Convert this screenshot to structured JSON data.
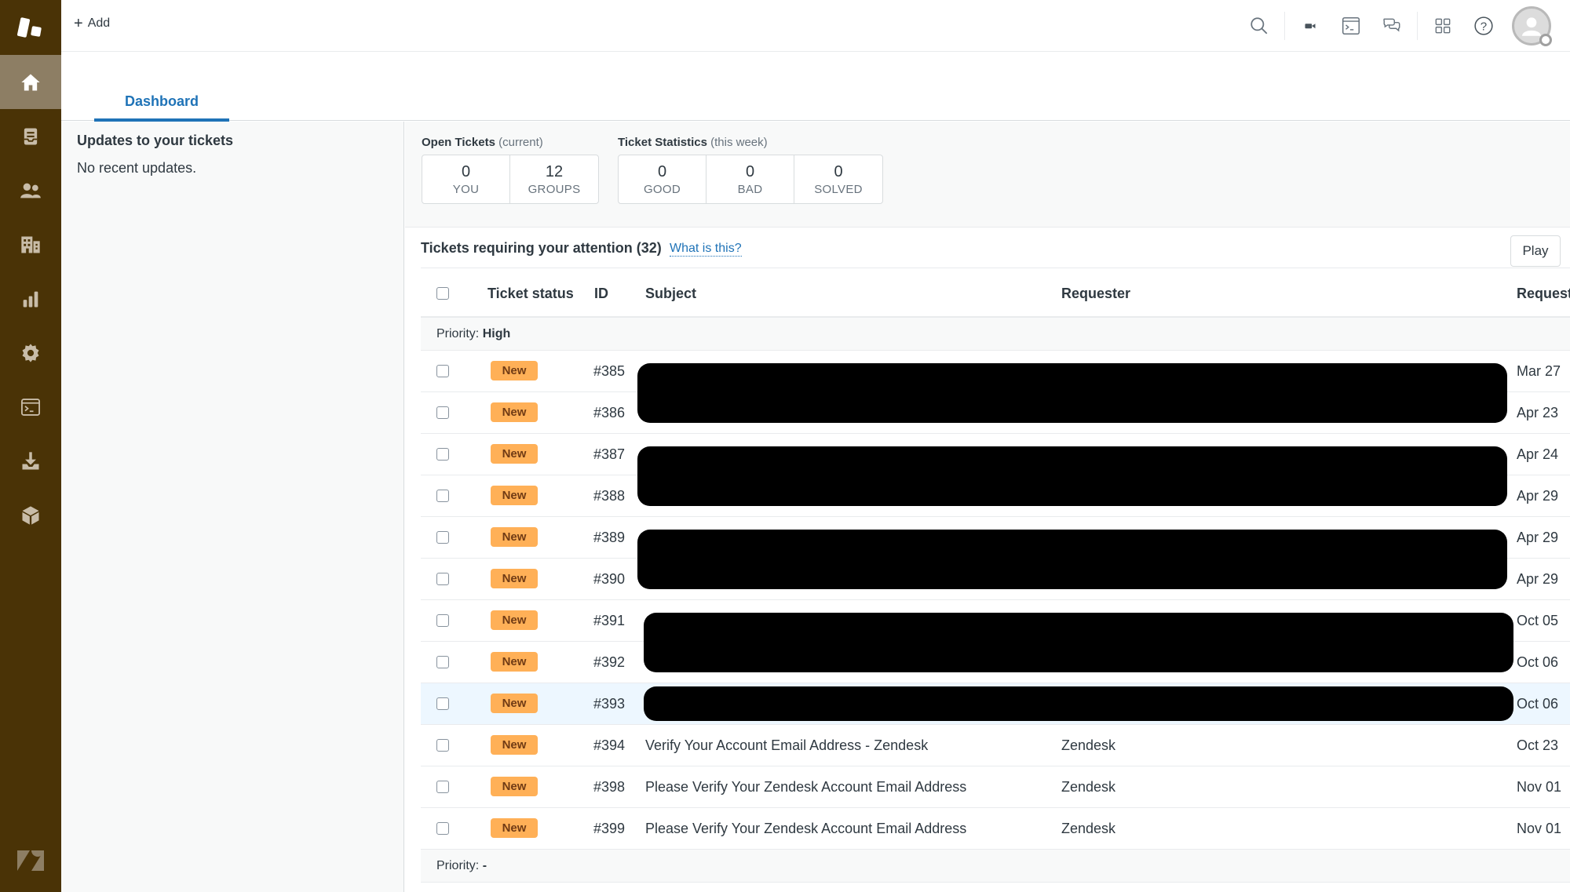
{
  "topbar": {
    "add_label": "Add",
    "icons": [
      "search-icon",
      "video-icon",
      "terminal-icon",
      "chat-icon",
      "apps-grid-icon",
      "help-icon",
      "user-avatar"
    ]
  },
  "sidebar": {
    "items": [
      {
        "name": "home",
        "icon": "home-icon",
        "active": true
      },
      {
        "name": "views",
        "icon": "inbox-icon"
      },
      {
        "name": "customers",
        "icon": "users-icon"
      },
      {
        "name": "organizations",
        "icon": "building-icon"
      },
      {
        "name": "reporting",
        "icon": "bar-chart-icon"
      },
      {
        "name": "admin",
        "icon": "gear-icon"
      },
      {
        "name": "console",
        "icon": "terminal-icon"
      },
      {
        "name": "downloads",
        "icon": "download-icon"
      },
      {
        "name": "apps",
        "icon": "cube-icon"
      }
    ]
  },
  "tabs": [
    {
      "label": "Dashboard",
      "active": true
    }
  ],
  "updates": {
    "title": "Updates to your tickets",
    "empty_text": "No recent updates."
  },
  "open_tickets": {
    "label": "Open Tickets",
    "sub": "(current)",
    "boxes": [
      {
        "value": "0",
        "caption": "YOU"
      },
      {
        "value": "12",
        "caption": "GROUPS"
      }
    ]
  },
  "ticket_stats": {
    "label": "Ticket Statistics",
    "sub": "(this week)",
    "boxes": [
      {
        "value": "0",
        "caption": "GOOD"
      },
      {
        "value": "0",
        "caption": "BAD"
      },
      {
        "value": "0",
        "caption": "SOLVED"
      }
    ]
  },
  "attention": {
    "title": "Tickets requiring your attention (32)",
    "link": "What is this?",
    "play_label": "Play"
  },
  "table": {
    "columns": [
      "Ticket status",
      "ID",
      "Subject",
      "Requester",
      "Requester updated"
    ],
    "visible_last_column": "Requeste",
    "groups": [
      {
        "label": "Priority:",
        "value": "High",
        "rows": [
          {
            "status": "New",
            "id": "#385",
            "subject": "",
            "requester": "",
            "date": "Mar 27",
            "redacted": true
          },
          {
            "status": "New",
            "id": "#386",
            "subject": "",
            "requester": "",
            "date": "Apr 23",
            "redacted": true
          },
          {
            "status": "New",
            "id": "#387",
            "subject": "",
            "requester": "",
            "date": "Apr 24",
            "redacted": true
          },
          {
            "status": "New",
            "id": "#388",
            "subject": "",
            "requester": "",
            "date": "Apr 29",
            "redacted": true
          },
          {
            "status": "New",
            "id": "#389",
            "subject": "",
            "requester": "",
            "date": "Apr 29",
            "redacted": true
          },
          {
            "status": "New",
            "id": "#390",
            "subject": "",
            "requester": "",
            "date": "Apr 29",
            "redacted": true
          },
          {
            "status": "New",
            "id": "#391",
            "subject": "",
            "requester": "",
            "date": "Oct 05",
            "redacted": true
          },
          {
            "status": "New",
            "id": "#392",
            "subject": "",
            "requester": "",
            "date": "Oct 06",
            "redacted": true
          },
          {
            "status": "New",
            "id": "#393",
            "subject": "",
            "requester": "",
            "date": "Oct 06",
            "redacted": true,
            "highlighted": true
          },
          {
            "status": "New",
            "id": "#394",
            "subject": "Verify Your Account Email Address - Zendesk",
            "requester": "Zendesk",
            "date": "Oct 23"
          },
          {
            "status": "New",
            "id": "#398",
            "subject": "Please Verify Your Zendesk Account Email Address",
            "requester": "Zendesk",
            "date": "Nov 01"
          },
          {
            "status": "New",
            "id": "#399",
            "subject": "Please Verify Your Zendesk Account Email Address",
            "requester": "Zendesk",
            "date": "Nov 01"
          }
        ]
      },
      {
        "label": "Priority:",
        "value": "-",
        "rows": []
      }
    ]
  },
  "colors": {
    "sidebar_bg": "#4a3306",
    "sidebar_active": "#8d7e64",
    "accent_blue": "#1f73b7",
    "badge_new_bg": "#ffb057",
    "badge_new_text": "#703b15",
    "row_highlight": "#edf7ff"
  }
}
